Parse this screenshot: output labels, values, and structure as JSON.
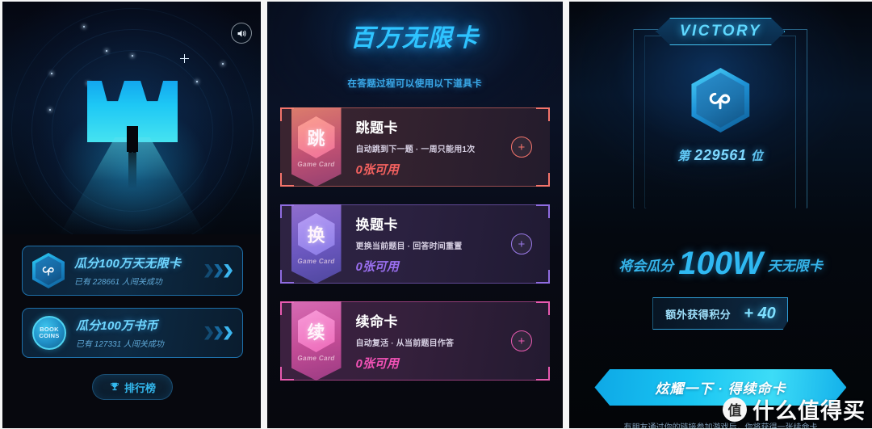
{
  "left_panel": {
    "name": "game-intro-screen",
    "sound_icon": "speaker-on-icon",
    "hero_alt": "crown-gate-silhouette",
    "rewards": [
      {
        "icon": "infinity-card-hex-icon",
        "title": "瓜分100万天无限卡",
        "subtitle": "已有 228661 人闯关成功",
        "arrow": "triple-chevron-right-icon"
      },
      {
        "icon": "book-coins-icon",
        "icon_line1": "BOOK",
        "icon_line2": "COINS",
        "title": "瓜分100万书币",
        "subtitle": "已有 127331 人闯关成功",
        "arrow": "triple-chevron-right-icon"
      }
    ],
    "rank_button": {
      "icon": "trophy-icon",
      "label": "排行榜"
    }
  },
  "mid_panel": {
    "title": "百万无限卡",
    "subtitle": "在答题过程可以使用以下道具卡",
    "cards": [
      {
        "glyph": "跳",
        "badge_label": "Game Card",
        "name": "跳题卡",
        "desc": "自动跳到下一题 · 一周只能用1次",
        "count": "0张可用",
        "add_label": "+",
        "accent": "#f4746b"
      },
      {
        "glyph": "换",
        "badge_label": "Game Card",
        "name": "换题卡",
        "desc": "更换当前题目 · 回答时间重置",
        "count": "0张可用",
        "add_label": "+",
        "accent": "#8f6ce0"
      },
      {
        "glyph": "续",
        "badge_label": "Game Card",
        "name": "续命卡",
        "desc": "自动复活 · 从当前题目作答",
        "count": "0张可用",
        "add_label": "+",
        "accent": "#e85ab0"
      }
    ]
  },
  "right_panel": {
    "victory_label": "VICTORY",
    "badge_icon": "infinity-card-hex-icon",
    "rank_prefix": "第",
    "rank_number": "229561",
    "rank_suffix": "位",
    "share_prefix": "将会瓜分",
    "share_amount": "100W",
    "share_suffix": "天无限卡",
    "points_label": "额外获得积分",
    "points_value": "+ 40",
    "cta_label": "炫耀一下 · 得续命卡",
    "cta_note": "有朋友通过你的链接参加游戏后，你将获得一张续命卡"
  },
  "watermark": {
    "logo": "值",
    "text": "什么值得买"
  }
}
